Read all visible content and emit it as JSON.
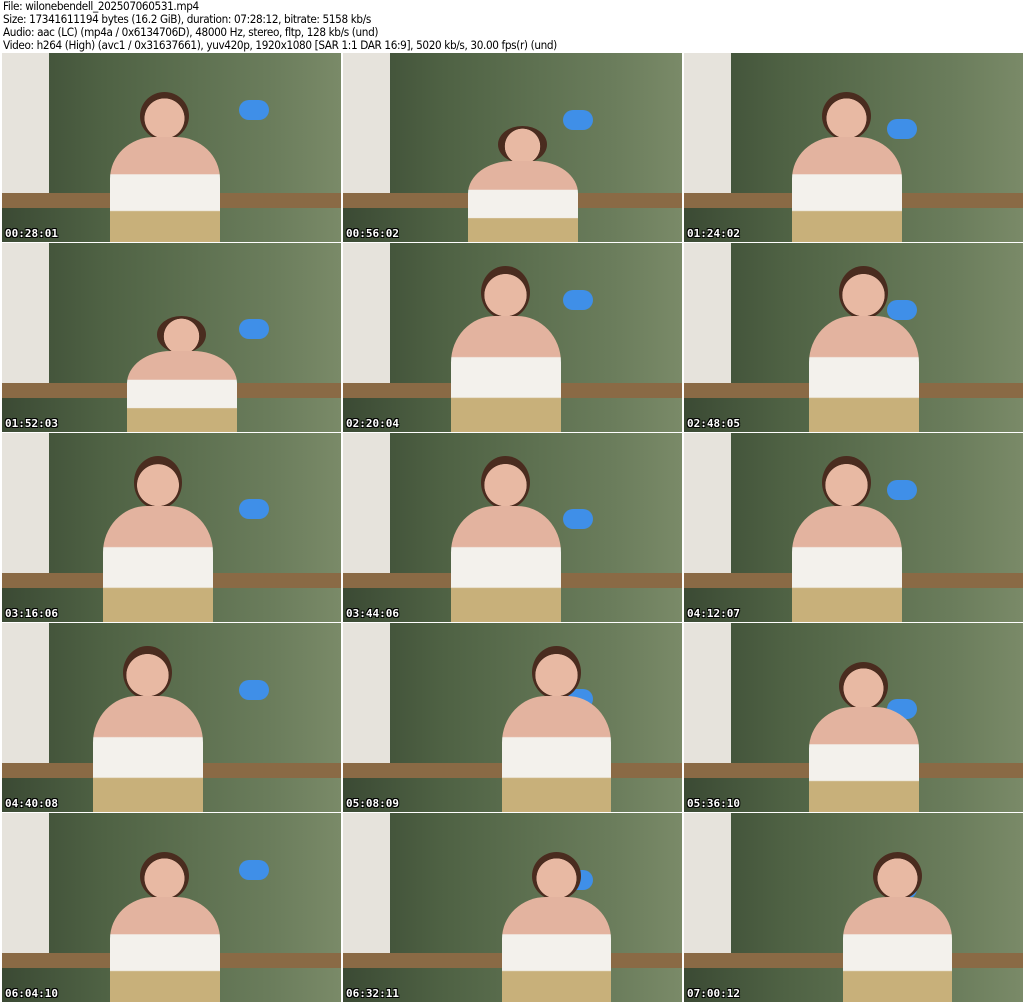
{
  "header": {
    "file": "File: wilonebendell_202507060531.mp4",
    "size": "Size: 17341611194 bytes (16.2 GiB), duration: 07:28:12, bitrate: 5158 kb/s",
    "audio": "Audio: aac (LC) (mp4a / 0x6134706D), 48000 Hz, stereo, fltp, 128 kb/s (und)",
    "video": "Video: h264 (High) (avc1 / 0x31637661), yuv420p, 1920x1080 [SAR 1:1 DAR 16:9], 5020 kb/s, 30.00 fps(r) (und)"
  },
  "thumbnails": [
    {
      "timestamp": "00:28:01"
    },
    {
      "timestamp": "00:56:02"
    },
    {
      "timestamp": "01:24:02"
    },
    {
      "timestamp": "01:52:03"
    },
    {
      "timestamp": "02:20:04"
    },
    {
      "timestamp": "02:48:05"
    },
    {
      "timestamp": "03:16:06"
    },
    {
      "timestamp": "03:44:06"
    },
    {
      "timestamp": "04:12:07"
    },
    {
      "timestamp": "04:40:08"
    },
    {
      "timestamp": "05:08:09"
    },
    {
      "timestamp": "05:36:10"
    },
    {
      "timestamp": "06:04:10"
    },
    {
      "timestamp": "06:32:11"
    },
    {
      "timestamp": "07:00:12"
    }
  ]
}
